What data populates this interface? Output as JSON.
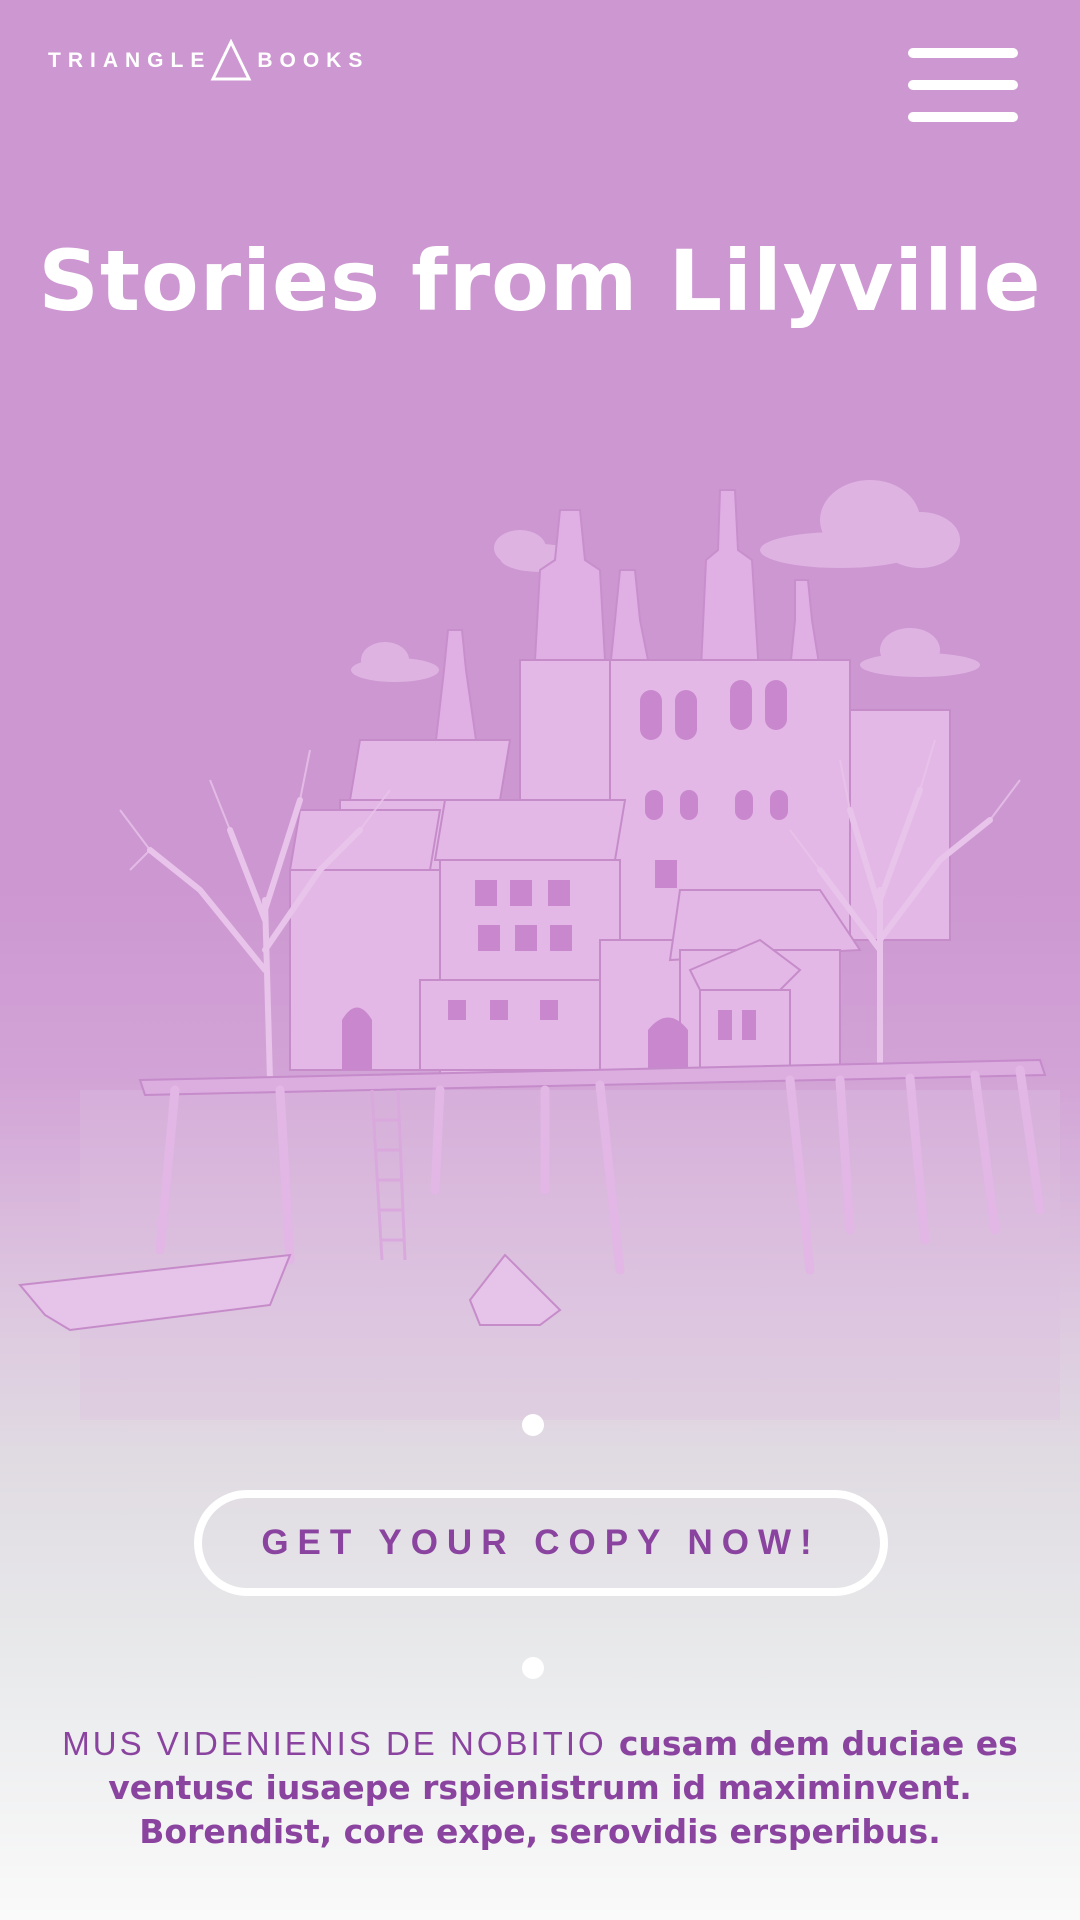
{
  "header": {
    "logo_left": "TRIANGLE",
    "logo_right": "BOOKS",
    "logo_icon": "triangle-icon",
    "menu_icon": "hamburger-menu-icon"
  },
  "hero": {
    "title": "Stories from Lilyville"
  },
  "cta": {
    "label": "GET YOUR COPY NOW!"
  },
  "blurb": {
    "lead": "MUS VIDENIENIS DE NOBITIO",
    "body": "cusam dem duciae es ventusc iusaepe rspienistrum id maximinvent. Borendist, core expe, serovidis ersperibus."
  },
  "colors": {
    "background": "#cd97d1",
    "accent": "#8a44a0",
    "white": "#ffffff"
  }
}
